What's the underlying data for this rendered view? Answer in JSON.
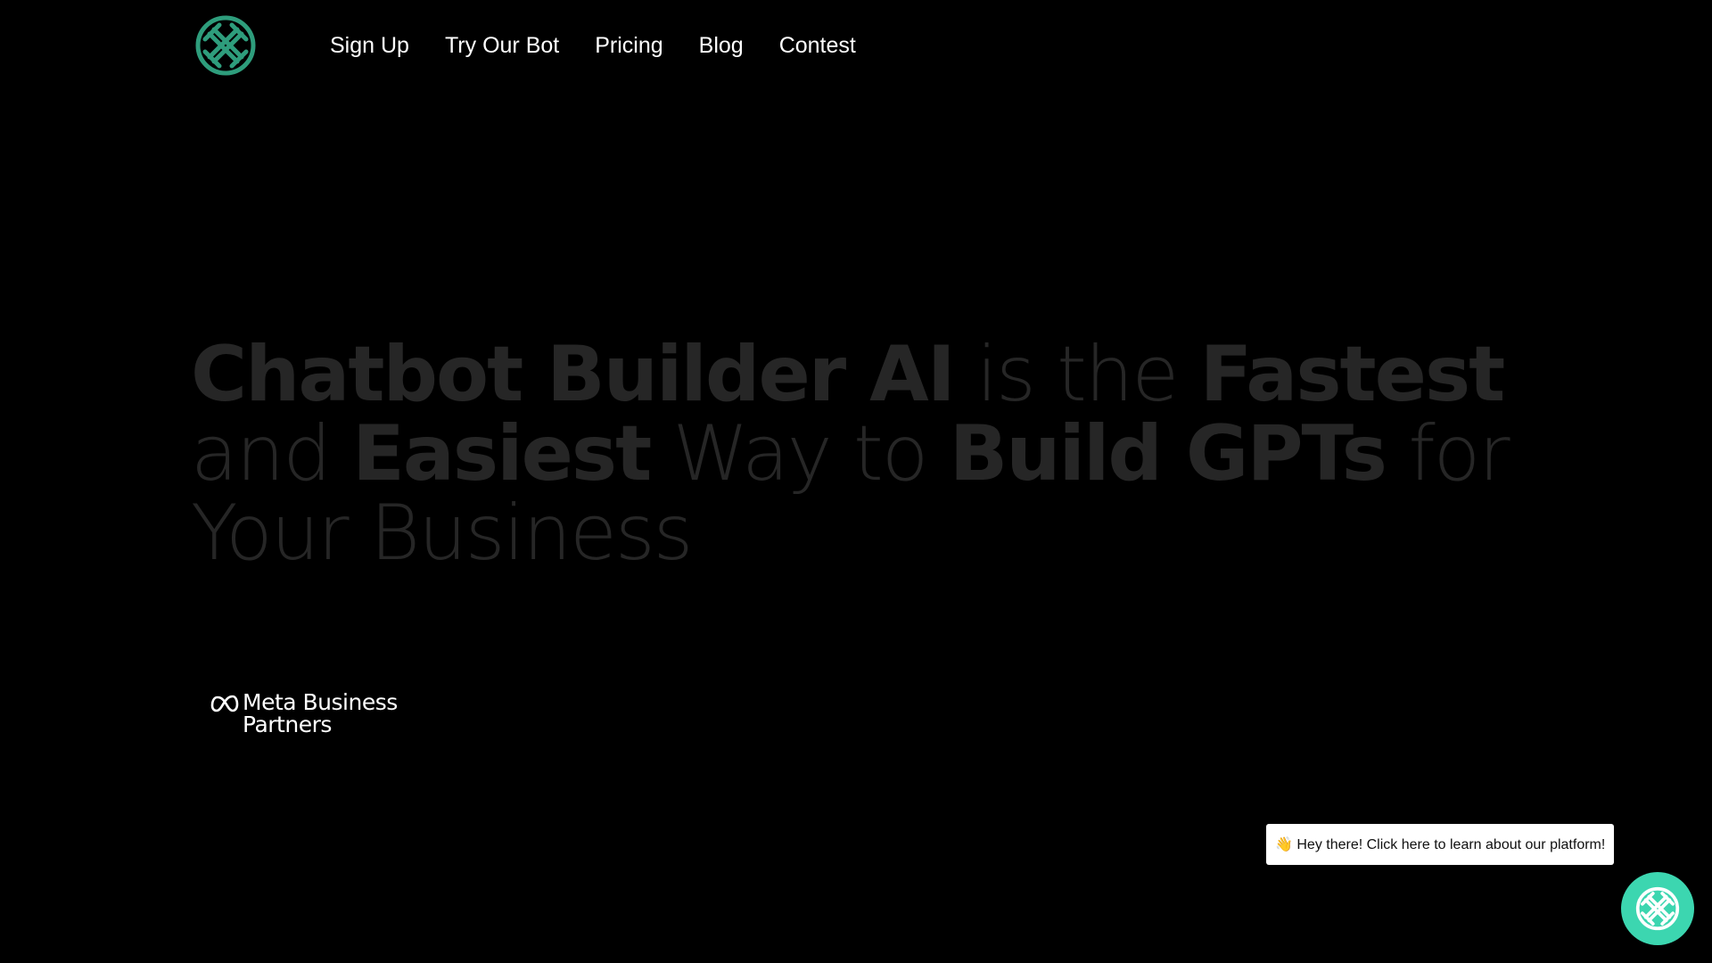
{
  "header": {
    "logo_icon": "knot-logo-icon",
    "nav": [
      {
        "label": "Sign Up"
      },
      {
        "label": "Try Our Bot"
      },
      {
        "label": "Pricing"
      },
      {
        "label": "Blog"
      },
      {
        "label": "Contest"
      }
    ]
  },
  "hero": {
    "line1": {
      "bold1": "Chatbot Builder AI",
      "light1": " is the ",
      "bold2": "Fastest"
    },
    "line2": {
      "light1": "and ",
      "bold1": "Easiest",
      "light2": " Way to ",
      "bold2": "Build GPTs",
      "light3": " for"
    },
    "line3": {
      "light1": "Your Business"
    }
  },
  "partner": {
    "icon": "meta-infinity-icon",
    "line1": "Meta Business",
    "line2": "Partners"
  },
  "chat": {
    "bubble_text": "👋 Hey there! Click here to learn about our platform!",
    "launcher_icon": "knot-logo-icon"
  },
  "colors": {
    "background": "#000000",
    "accent": "#3cd6b0",
    "logo": "#2e9d7c",
    "hero_text": "#262626"
  }
}
